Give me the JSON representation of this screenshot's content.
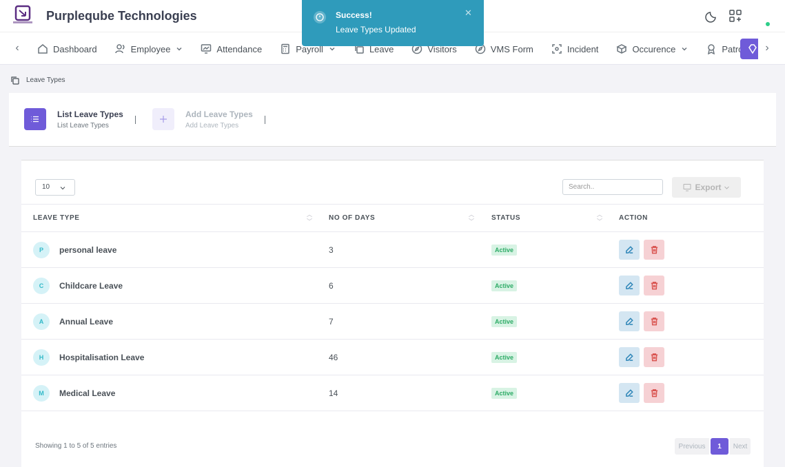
{
  "app": {
    "brand": "Purpleqube Technologies",
    "logo_text": "PURPLEQUBE"
  },
  "toast": {
    "title": "Success!",
    "message": "Leave Types Updated"
  },
  "nav": {
    "items": [
      {
        "label": "Dashboard",
        "icon": "home-icon"
      },
      {
        "label": "Employee",
        "icon": "users-icon",
        "has_dropdown": true
      },
      {
        "label": "Attendance",
        "icon": "monitor-chart-icon"
      },
      {
        "label": "Payroll",
        "icon": "calculator-icon",
        "has_dropdown": true
      },
      {
        "label": "Leave",
        "icon": "copy-icon"
      },
      {
        "label": "Visitors",
        "icon": "compass-icon"
      },
      {
        "label": "VMS Form",
        "icon": "compass-icon"
      },
      {
        "label": "Incident",
        "icon": "focus-icon"
      },
      {
        "label": "Occurence",
        "icon": "boxes-icon",
        "has_dropdown": true
      },
      {
        "label": "Patrol",
        "icon": "badge-icon"
      }
    ]
  },
  "breadcrumb": {
    "label": "Leave Types"
  },
  "tabs": {
    "list_title": "List Leave Types",
    "list_sub": "List Leave Types",
    "add_title": "Add Leave Types",
    "add_sub": "Add Leave Types"
  },
  "table": {
    "length_value": "10",
    "search_placeholder": "Search..",
    "export_label": "Export",
    "columns": [
      "LEAVE TYPE",
      "NO OF DAYS",
      "STATUS",
      "ACTION"
    ],
    "rows": [
      {
        "initial": "P",
        "name": "personal leave",
        "days": "3",
        "status": "Active"
      },
      {
        "initial": "C",
        "name": "Childcare Leave",
        "days": "6",
        "status": "Active"
      },
      {
        "initial": "A",
        "name": "Annual Leave",
        "days": "7",
        "status": "Active"
      },
      {
        "initial": "H",
        "name": "Hospitalisation Leave",
        "days": "46",
        "status": "Active"
      },
      {
        "initial": "M",
        "name": "Medical Leave",
        "days": "14",
        "status": "Active"
      }
    ],
    "entries_text": "Showing 1 to 5 of 5 entries",
    "pagination": {
      "previous": "Previous",
      "current": "1",
      "next": "Next"
    }
  },
  "colors": {
    "primary": "#6f5bd9",
    "toast": "#2f9bbb",
    "active_badge_bg": "#d8f3e4",
    "active_badge_text": "#2dab66"
  }
}
